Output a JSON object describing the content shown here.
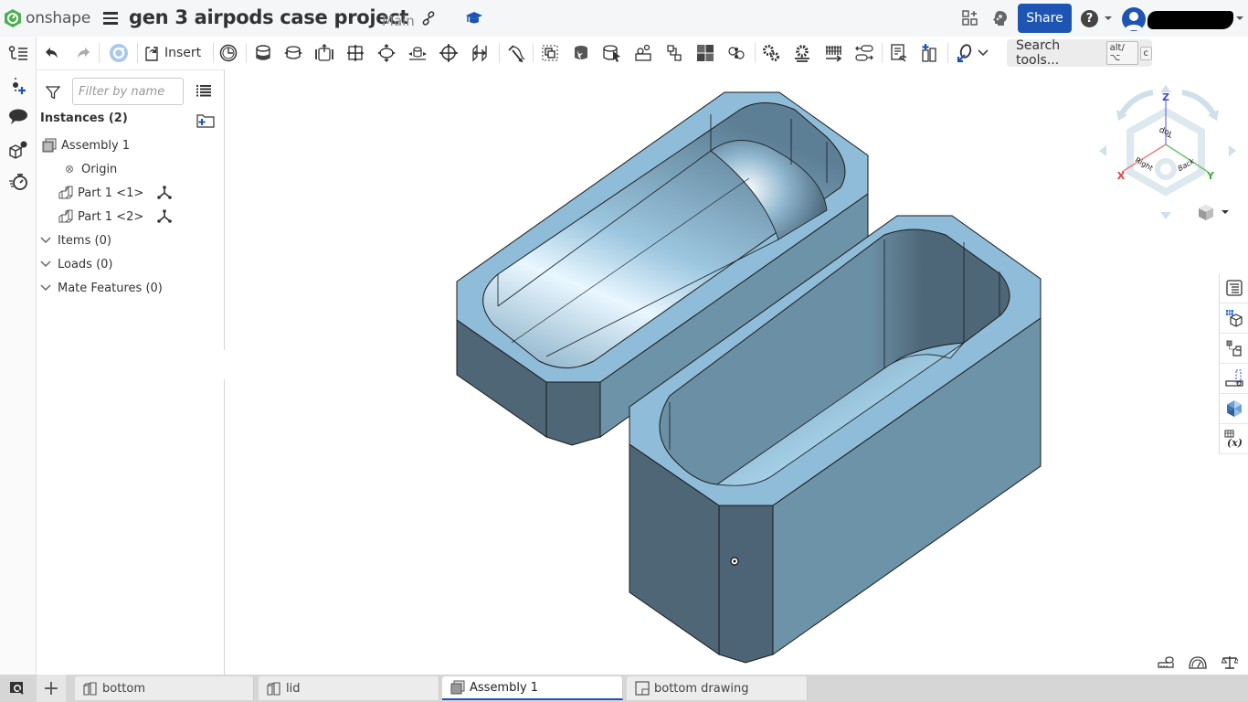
{
  "app": {
    "brand": "onshape",
    "accent": "#1e55b3"
  },
  "header": {
    "document_title": "gen 3 airpods case project",
    "branch": "Main",
    "share_label": "Share",
    "help_glyph": "?"
  },
  "left_rail": {
    "items": [
      {
        "name": "feature-list-icon"
      },
      {
        "name": "insert-mate-connector-icon"
      },
      {
        "name": "comments-icon"
      },
      {
        "name": "configuration-icon"
      },
      {
        "name": "performance-timer-icon"
      }
    ]
  },
  "toolbar": {
    "insert_label": "Insert",
    "search_placeholder": "Search tools...",
    "shortcut_1": "alt/⌥",
    "shortcut_2": "c"
  },
  "panel": {
    "filter_placeholder": "Filter by name",
    "instances_header": "Instances (2)",
    "tree": [
      {
        "label": "Assembly 1",
        "type": "assembly"
      },
      {
        "label": "Origin",
        "type": "origin"
      },
      {
        "label": "Part 1 <1>",
        "type": "part"
      },
      {
        "label": "Part 1 <2>",
        "type": "part"
      }
    ],
    "sections": [
      {
        "label": "Items (0)"
      },
      {
        "label": "Loads (0)"
      },
      {
        "label": "Mate Features (0)"
      }
    ]
  },
  "viewcube": {
    "axis_z": "Z",
    "axis_x": "X",
    "axis_y": "Y",
    "face_top": "Top",
    "face_right": "Right",
    "face_back": "Back",
    "colors": {
      "x": "#e04040",
      "y": "#3ab03a",
      "z": "#4a4ad8"
    }
  },
  "model_colors": {
    "top": "#8fbcd8",
    "side_light": "#6d93a8",
    "side_dark": "#4d6475",
    "highlight": "#eaf7ff",
    "edge": "#1a1a1a"
  },
  "tabs": [
    {
      "label": "bottom",
      "type": "part-studio",
      "active": false
    },
    {
      "label": "lid",
      "type": "part-studio",
      "active": false
    },
    {
      "label": "Assembly 1",
      "type": "assembly",
      "active": true
    },
    {
      "label": "bottom drawing",
      "type": "drawing",
      "active": false
    }
  ],
  "tab_add_glyph": "+"
}
